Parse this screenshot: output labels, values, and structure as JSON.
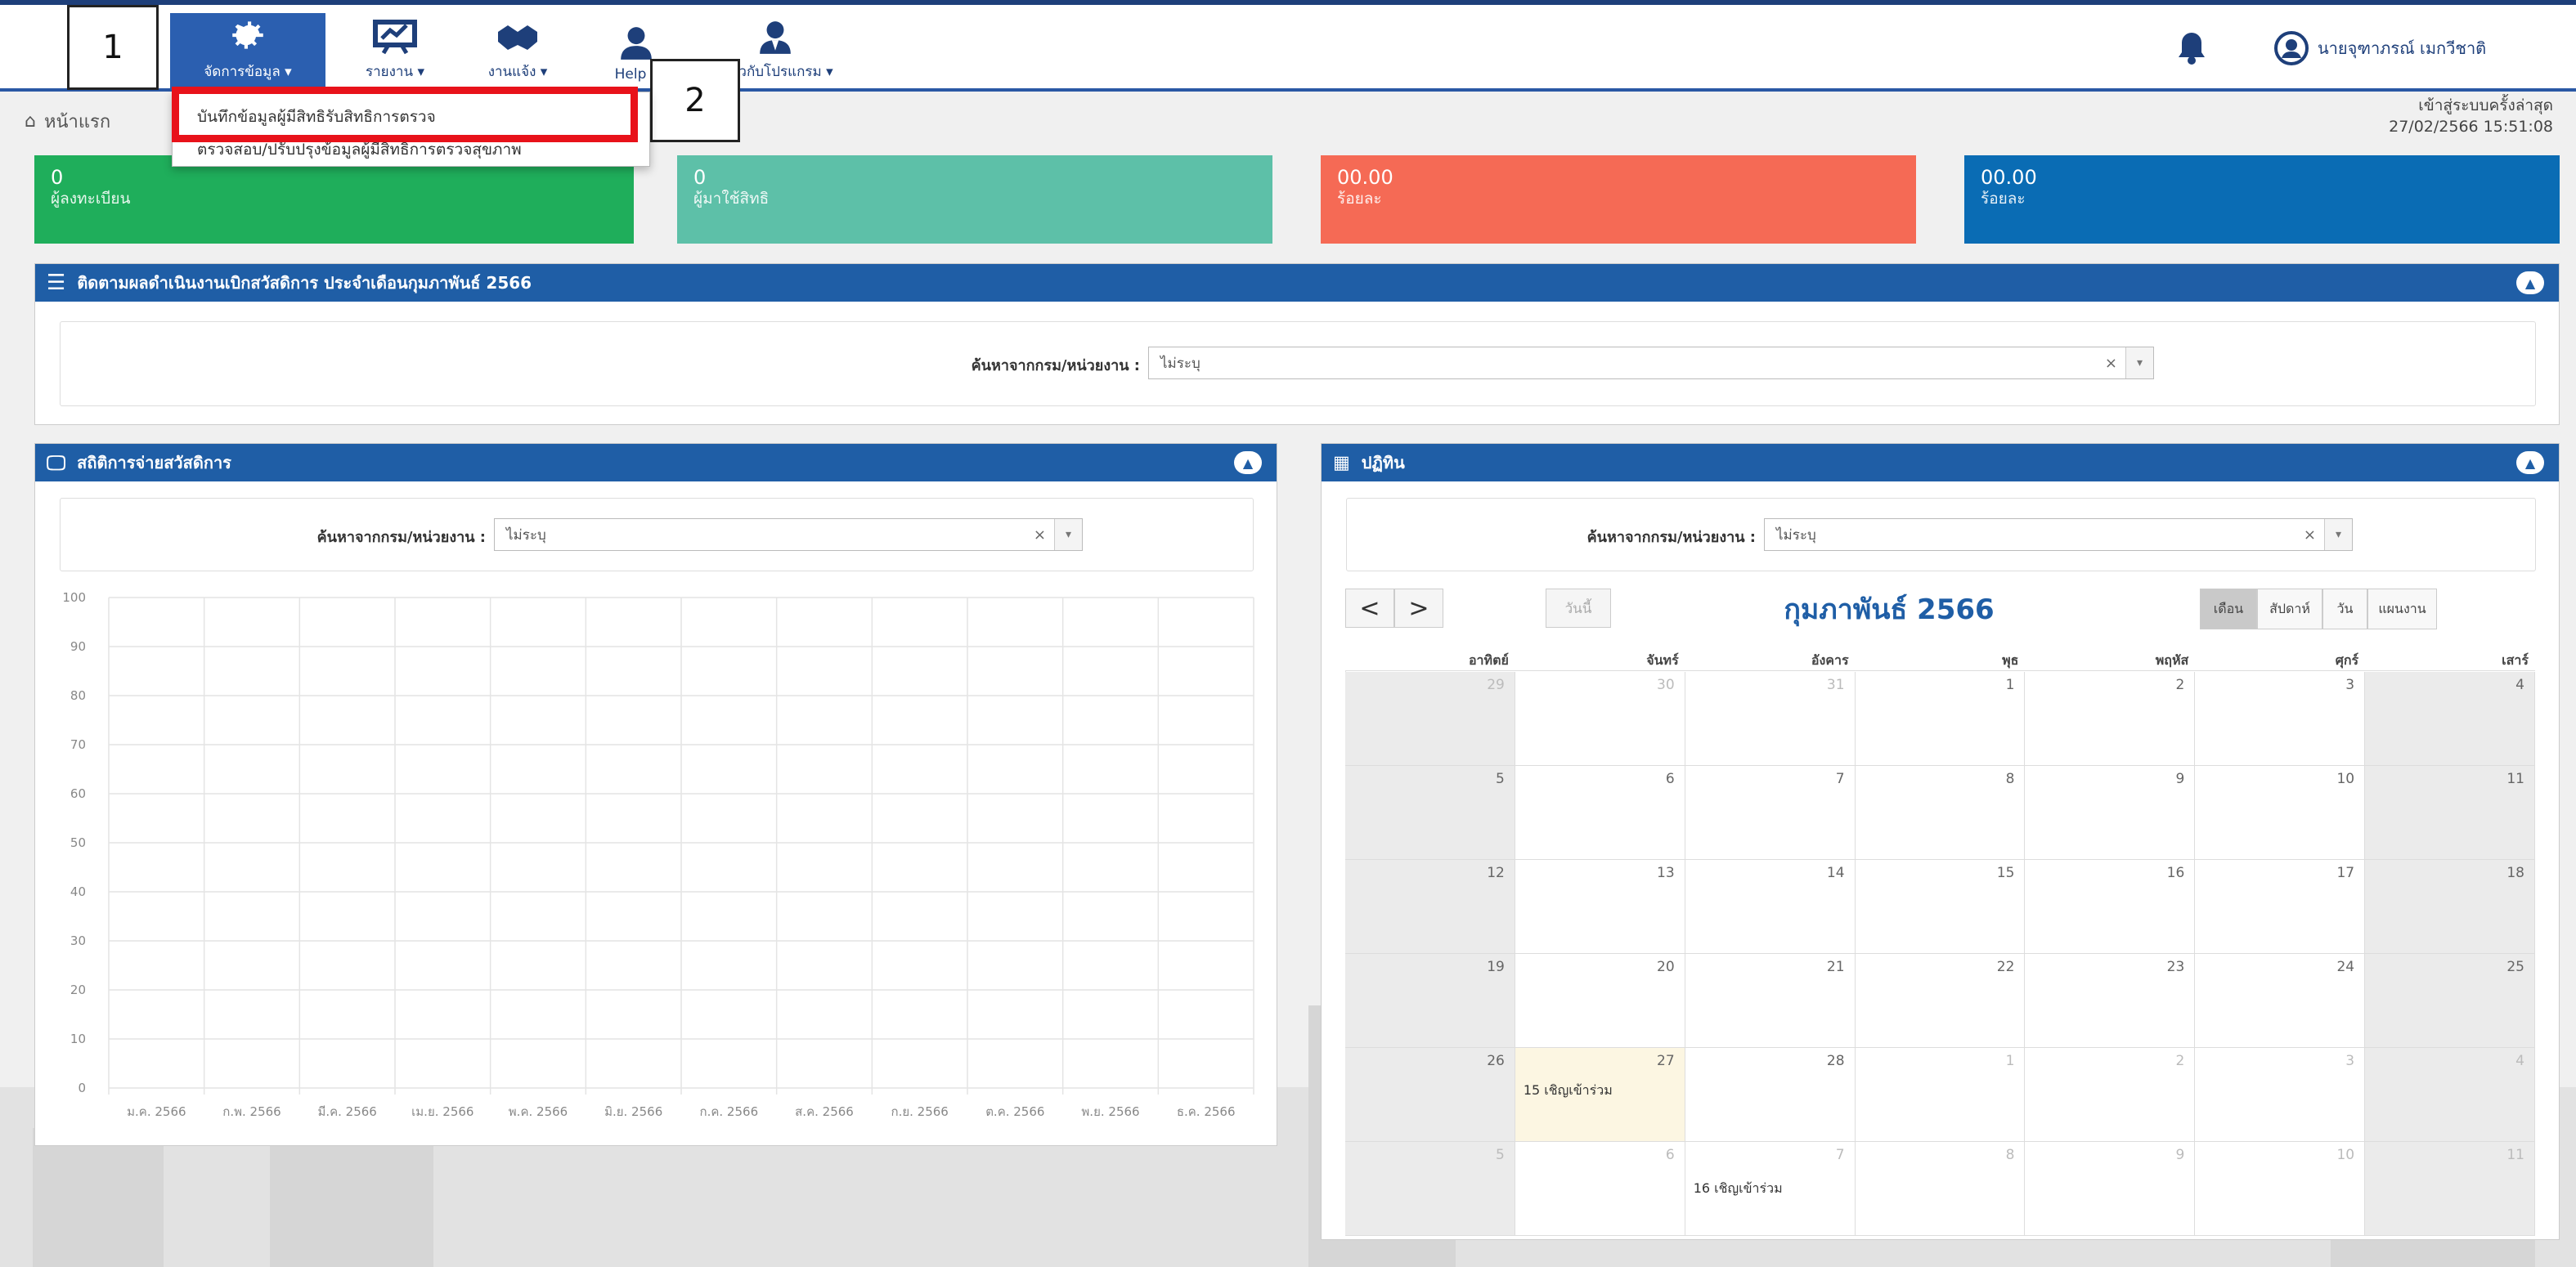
{
  "topbar": {
    "nav": [
      {
        "label": "จัดการข้อมูล ▾"
      },
      {
        "label": "รายงาน ▾"
      },
      {
        "label": "งานแจ้ง ▾"
      },
      {
        "label": "Help ▾"
      },
      {
        "label": "เกี่ยวกับโปรแกรม ▾"
      }
    ],
    "user_name": "นายจุฑาภรณ์ เมกวีชาติ",
    "callout_1": "1",
    "callout_2": "2"
  },
  "dropdown": {
    "items": [
      {
        "label": "บันทึกข้อมูลผู้มีสิทธิรับสิทธิการตรวจ"
      },
      {
        "label": "ตรวจสอบ/ปรับปรุงข้อมูลผู้มีสิทธิการตรวจสุขภาพ"
      }
    ]
  },
  "breadcrumb": {
    "home": "หน้าแรก"
  },
  "last_login": {
    "label": "เข้าสู่ระบบครั้งล่าสุด",
    "datetime": "27/02/2566 15:51:08"
  },
  "cards": [
    {
      "value": "0",
      "label": "ผู้ลงทะเบียน",
      "color": "#1fae5b"
    },
    {
      "value": "0",
      "label": "ผู้มาใช้สิทธิ",
      "color": "#5dc0a8"
    },
    {
      "value": "00.00",
      "label": "ร้อยละ",
      "color": "#f56a55"
    },
    {
      "value": "00.00",
      "label": "ร้อยละ",
      "color": "#0a6cb4"
    }
  ],
  "tracking_panel": {
    "title": "ติดตามผลดำเนินงานเบิกสวัสดิการ ประจำเดือนกุมภาพันธ์ 2566",
    "filter_label": "ค้นหาจากกรม/หน่วยงาน :",
    "filter_value": "ไม่ระบุ"
  },
  "chart_panel": {
    "title": "สถิติการจ่ายสวัสดิการ",
    "filter_label": "ค้นหาจากกรม/หน่วยงาน :",
    "filter_value": "ไม่ระบุ"
  },
  "chart_data": {
    "type": "bar",
    "title": "",
    "ylim": [
      0,
      100
    ],
    "yticks": [
      "0",
      "10",
      "20",
      "30",
      "40",
      "50",
      "60",
      "70",
      "80",
      "90",
      "100"
    ],
    "categories": [
      "ม.ค. 2566",
      "ก.พ. 2566",
      "มี.ค. 2566",
      "เม.ย. 2566",
      "พ.ค. 2566",
      "มิ.ย. 2566",
      "ก.ค. 2566",
      "ส.ค. 2566",
      "ก.ย. 2566",
      "ต.ค. 2566",
      "พ.ย. 2566",
      "ธ.ค. 2566"
    ],
    "values": [
      0,
      0,
      0,
      0,
      0,
      0,
      0,
      0,
      0,
      0,
      0,
      0
    ],
    "grid": true
  },
  "calendar_panel": {
    "title": "ปฏิทิน",
    "filter_label": "ค้นหาจากกรม/หน่วยงาน :",
    "filter_value": "ไม่ระบุ",
    "prev": "<",
    "next": ">",
    "today_btn": "วันนี้",
    "month_title": "กุมภาพันธ์ 2566",
    "views": [
      "เดือน",
      "สัปดาห์",
      "วัน",
      "แผนงาน"
    ],
    "weekdays": [
      "อาทิตย์",
      "จันทร์",
      "อังคาร",
      "พุธ",
      "พฤหัส",
      "ศุกร์",
      "เสาร์"
    ],
    "weeks": [
      [
        "29",
        "30",
        "31",
        "1",
        "2",
        "3",
        "4"
      ],
      [
        "5",
        "6",
        "7",
        "8",
        "9",
        "10",
        "11"
      ],
      [
        "12",
        "13",
        "14",
        "15",
        "16",
        "17",
        "18"
      ],
      [
        "19",
        "20",
        "21",
        "22",
        "23",
        "24",
        "25"
      ],
      [
        "26",
        "27",
        "28",
        "1",
        "2",
        "3",
        "4"
      ],
      [
        "5",
        "6",
        "7",
        "8",
        "9",
        "10",
        "11"
      ]
    ],
    "events": [
      {
        "label": "15 เชิญเข้าร่วม",
        "week": 4,
        "day": 1
      },
      {
        "label": "16 เชิญเข้าร่วม",
        "week": 5,
        "day": 2
      }
    ]
  }
}
